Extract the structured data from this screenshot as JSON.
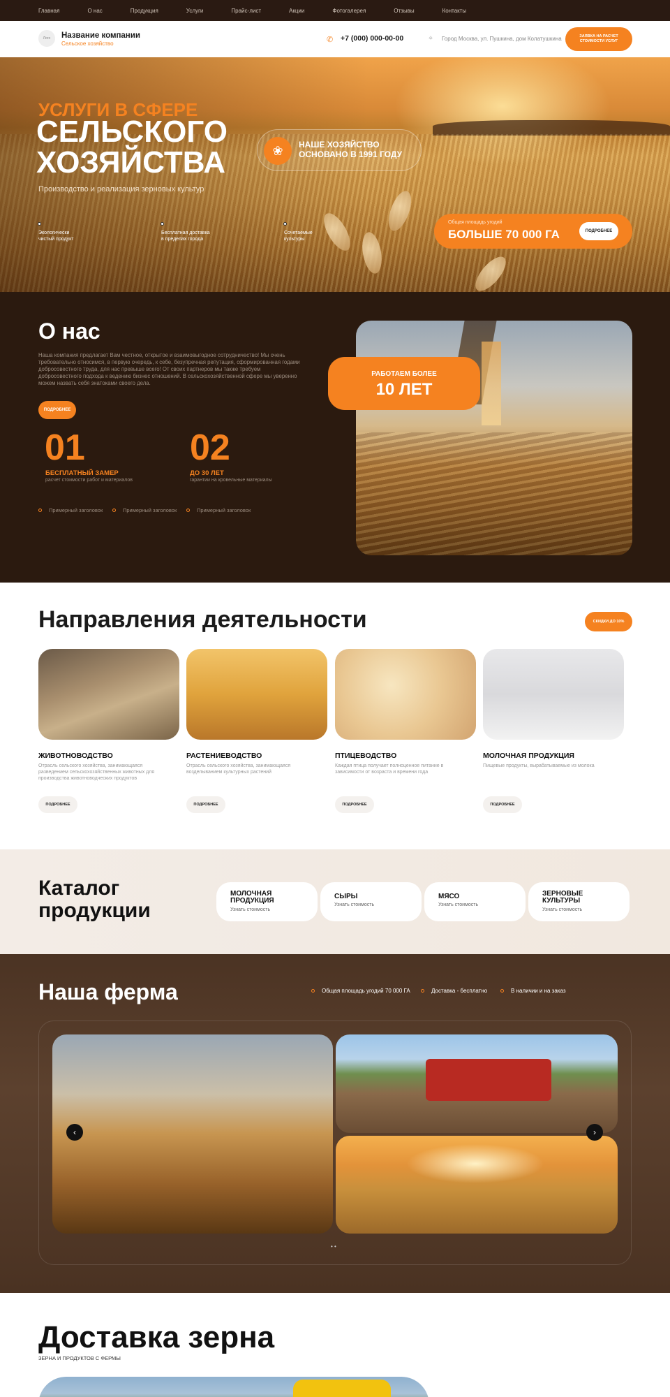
{
  "topnav": [
    "Главная",
    "О нас",
    "Продукция",
    "Услуги",
    "Прайс-лист",
    "Акции",
    "Фотогалерея",
    "Отзывы",
    "Контакты"
  ],
  "header": {
    "logo_text": "Лого",
    "company": "Название компании",
    "company_sub": "Сельское хозяйство",
    "phone": "+7 (000) 000-00-00",
    "address": "Город Москва, ул. Пушкина, дом Колатушкина",
    "cta_line1": "ЗАЯВКА НА РАСЧЕТ",
    "cta_line2": "СТОИМОСТИ УСЛУГ"
  },
  "hero": {
    "title_line1": "УСЛУГИ В СФЕРЕ",
    "title_line2": "СЕЛЬСКОГО",
    "title_line3": "ХОЗЯЙСТВА",
    "subtitle": "Производство и реализация зерновых культур",
    "badge_line1": "НАШЕ ХОЗЯЙСТВО",
    "badge_line2": "ОСНОВАНО В 1991 ГОДУ",
    "features": [
      {
        "line1": "Экологически",
        "line2": "чистый продукт"
      },
      {
        "line1": "Бесплатная доставка",
        "line2": "в пределах города"
      },
      {
        "line1": "Сочетаемые",
        "line2": "культуры"
      }
    ],
    "area_label": "Общая площадь угодий",
    "area_value": "БОЛЬШЕ 70 000 ГА",
    "area_button": "ПОДРОБНЕЕ"
  },
  "about": {
    "title": "О нас",
    "text": "Наша компания предлагает Вам честное, открытое и взаимовыгодное сотрудничество! Мы очень требовательно относимся, в первую очередь, к себе, безупречная репутация, сформированная годами добросовестного труда, для нас превыше всего! От своих партнеров мы также требуем добросовестного подхода к ведению бизнес отношений. В сельскохозяйственной сфере мы уверенно можем назвать себя знатоками своего дела.",
    "more": "ПОДРОБНЕЕ",
    "stats": [
      {
        "num": "01",
        "label": "БЕСПЛАТНЫЙ ЗАМЕР",
        "sub": "расчет стоимости работ и материалов"
      },
      {
        "num": "02",
        "label": "ДО 30 ЛЕТ",
        "sub": "гарантии на кровельные материалы"
      }
    ],
    "examples": [
      "Примерный заголовок",
      "Примерный заголовок",
      "Примерный заголовок"
    ],
    "years_line1": "РАБОТАЕМ БОЛЕЕ",
    "years_line2": "10 ЛЕТ"
  },
  "directions": {
    "title": "Направления деятельности",
    "button": "СКИДКИ ДО 10%",
    "cards": [
      {
        "title": "ЖИВОТНОВОДСТВО",
        "desc": "Отрасль сельского хозяйства, занимающаяся разведением сельскохозяйственных животных для производства животноводческих продуктов",
        "btn": "ПОДРОБНЕЕ"
      },
      {
        "title": "РАСТЕНИЕВОДСТВО",
        "desc": "Отрасль сельского хозяйства, занимающаяся возделыванием культурных растений",
        "btn": "ПОДРОБНЕЕ"
      },
      {
        "title": "ПТИЦЕВОДСТВО",
        "desc": "Каждая птица получает полноценное питание в зависимости от возраста и времени года",
        "btn": "ПОДРОБНЕЕ"
      },
      {
        "title": "МОЛОЧНАЯ ПРОДУКЦИЯ",
        "desc": "Пищевые продукты, вырабатываемые из молока",
        "btn": "ПОДРОБНЕЕ"
      }
    ]
  },
  "catalog": {
    "title_line1": "Каталог",
    "title_line2": "продукции",
    "items": [
      {
        "line1": "МОЛОЧНАЯ",
        "line2": "ПРОДУКЦИЯ",
        "sub": "Узнать стоимость"
      },
      {
        "line1": "СЫРЫ",
        "line2": "",
        "sub": "Узнать стоимость"
      },
      {
        "line1": "МЯСО",
        "line2": "",
        "sub": "Узнать стоимость"
      },
      {
        "line1": "ЗЕРНОВЫЕ",
        "line2": "КУЛЬТУРЫ",
        "sub": "Узнать стоимость"
      }
    ]
  },
  "farm": {
    "title": "Наша ферма",
    "points": [
      "Общая площадь угодий 70 000 ГА",
      "Доставка - бесплатно",
      "В наличии и на заказ"
    ],
    "prev": "‹",
    "next": "›",
    "dots": "• •"
  },
  "delivery": {
    "title": "Доставка зерна",
    "subtitle": "ЗЕРНА И ПРОДУКТОВ С ФЕРМЫ"
  },
  "colors": {
    "accent": "#f58220",
    "dark": "#2b1a0f",
    "farm_bg": "#4b3323"
  }
}
